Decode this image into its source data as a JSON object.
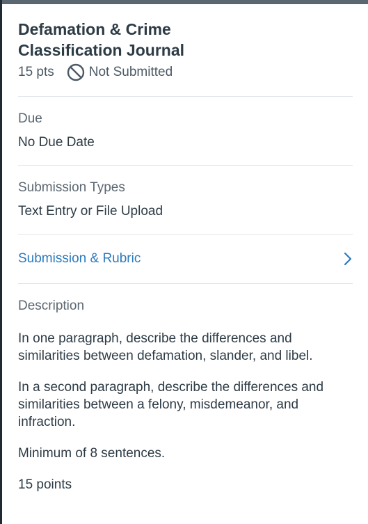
{
  "assignment": {
    "title": "Defamation & Crime Classification Journal",
    "points": "15 pts",
    "status": "Not Submitted",
    "status_icon": "not-submitted-icon"
  },
  "due": {
    "label": "Due",
    "value": "No Due Date"
  },
  "submission_types": {
    "label": "Submission Types",
    "value": "Text Entry or File Upload"
  },
  "rubric_link": {
    "label": "Submission & Rubric",
    "icon": "chevron-right-icon",
    "color": "#2b7abc"
  },
  "description": {
    "label": "Description",
    "paragraphs": [
      "In one paragraph, describe the differences and similarities between defamation, slander, and libel.",
      "In a second paragraph, describe the differences and similarities between a felony, misdemeanor, and infraction.",
      "Minimum of 8 sentences.",
      "15 points"
    ]
  }
}
